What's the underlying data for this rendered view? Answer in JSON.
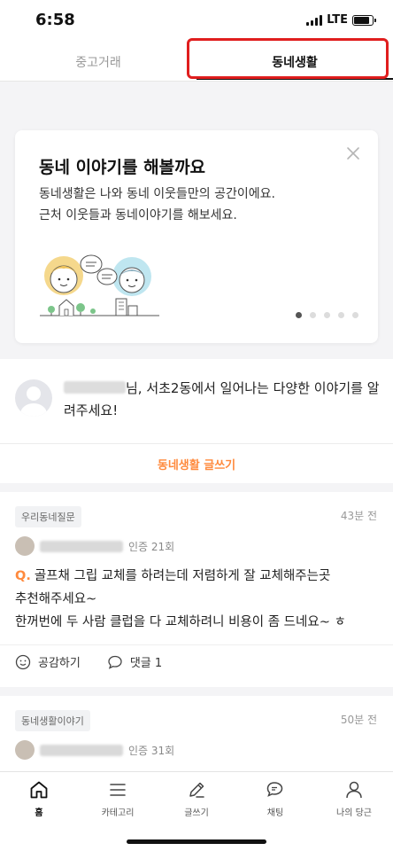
{
  "status_bar": {
    "time": "6:58",
    "network": "LTE",
    "battery_level": 0.85
  },
  "tabs": [
    {
      "label": "중고거래",
      "active": false
    },
    {
      "label": "동네생활",
      "active": true
    }
  ],
  "intro_card": {
    "title": "동네 이야기를 해볼까요",
    "description_line1": "동네생활은 나와 동네 이웃들만의 공간이에요.",
    "description_line2": "근처 이웃들과 동네이야기를 해보세요.",
    "page_count": 5,
    "active_page": 1
  },
  "prompt": {
    "message": "님, 서초2동에서 일어나는 다양한 이야기를 알려주세요!",
    "write_link": "동네생활 글쓰기"
  },
  "posts": [
    {
      "category": "우리동네질문",
      "time": "43분 전",
      "author_meta": "인증 21회",
      "q_label": "Q.",
      "line1": "골프채 그립 교체를 하려는데 저렴하게 잘 교체해주는곳",
      "line2": "추천해주세요~",
      "line3": "한꺼번에 두 사람 클럽을 다 교체하려니 비용이 좀 드네요~ ㅎ",
      "like_label": "공감하기",
      "comment_label": "댓글 1"
    },
    {
      "category": "동네생활이야기",
      "time": "50분 전",
      "author_meta": "인증 31회"
    }
  ],
  "bottom_nav": [
    {
      "label": "홈",
      "icon": "home-icon",
      "active": true
    },
    {
      "label": "카테고리",
      "icon": "menu-icon",
      "active": false
    },
    {
      "label": "글쓰기",
      "icon": "pencil-icon",
      "active": false
    },
    {
      "label": "채팅",
      "icon": "chat-icon",
      "active": false
    },
    {
      "label": "나의 당근",
      "icon": "person-icon",
      "active": false
    }
  ],
  "colors": {
    "accent": "#ff8a3d",
    "highlight": "#e01e1e",
    "background": "#f4f4f6"
  }
}
